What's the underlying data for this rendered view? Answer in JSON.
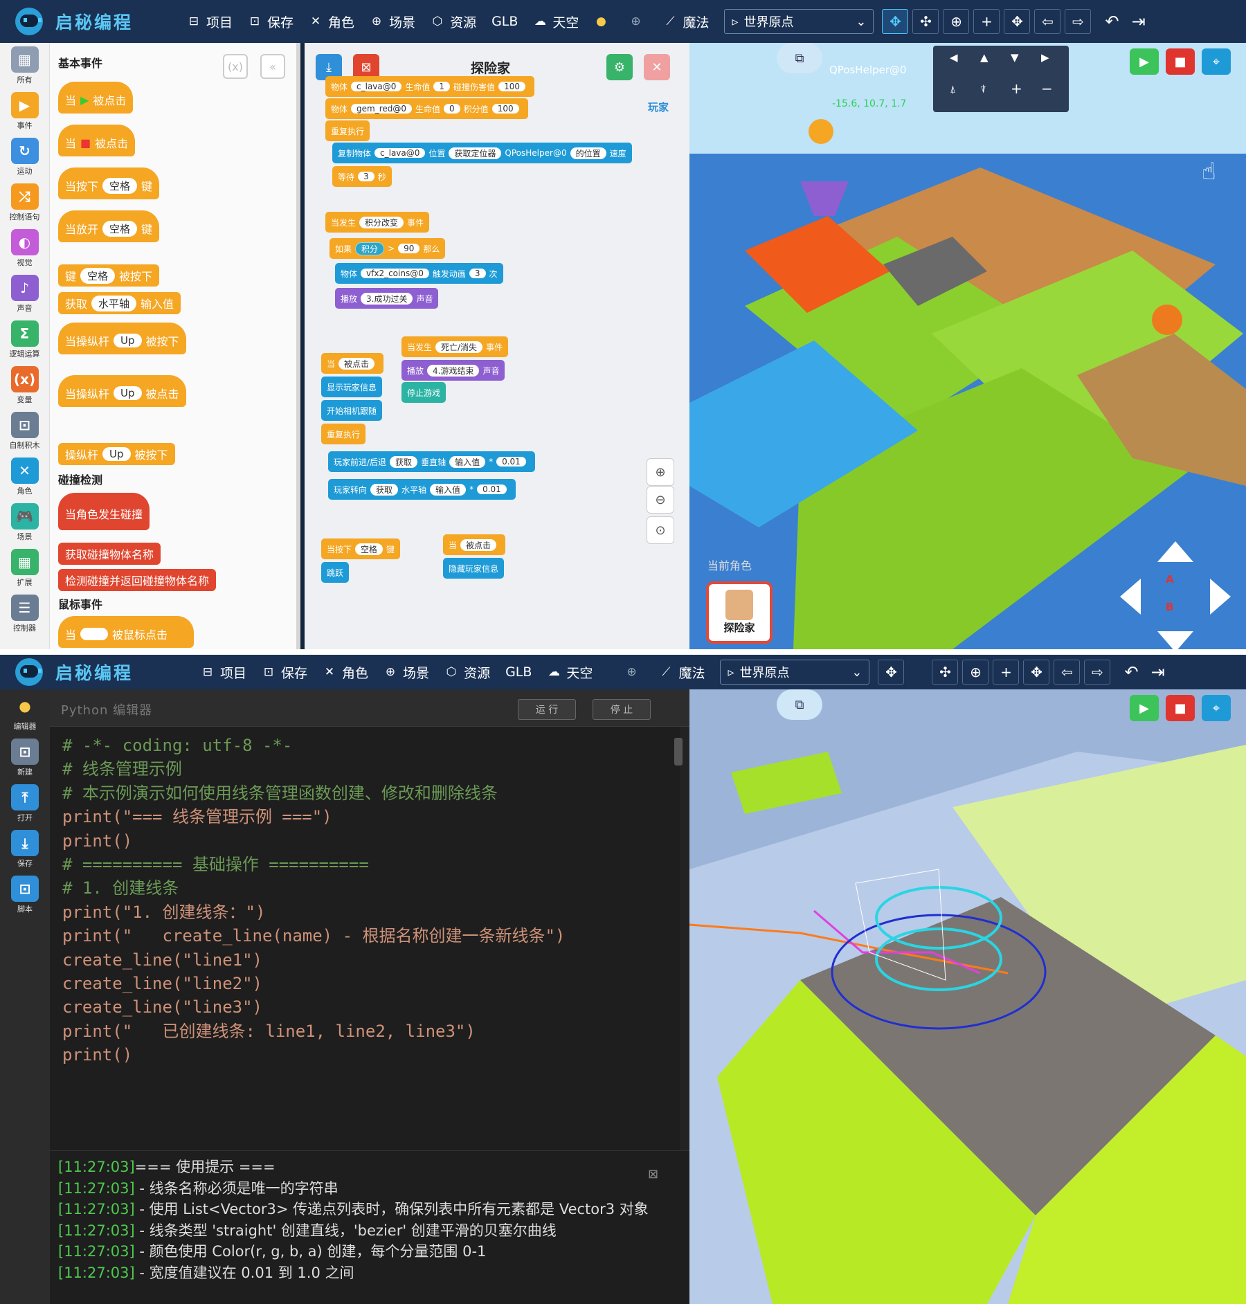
{
  "brand": "启秘编程",
  "menu": [
    {
      "icon": "save-file-icon",
      "label": "项目"
    },
    {
      "icon": "floppy-icon",
      "label": "保存"
    },
    {
      "icon": "character-icon",
      "label": "角色"
    },
    {
      "icon": "gamepad-icon",
      "label": "场景"
    },
    {
      "icon": "cube-icon",
      "label": "资源"
    },
    {
      "icon": "",
      "label": "GLB"
    },
    {
      "icon": "cloud-icon",
      "label": "天空"
    }
  ],
  "magic_label": "魔法",
  "world_origin": "世界原点",
  "categories": [
    {
      "label": "所有",
      "color": "#8f9db3",
      "glyph": "▦"
    },
    {
      "label": "事件",
      "color": "#f5a623",
      "glyph": "▶"
    },
    {
      "label": "运动",
      "color": "#3d8fe0",
      "glyph": "↻"
    },
    {
      "label": "控制语句",
      "color": "#f59a1f",
      "glyph": "⤮"
    },
    {
      "label": "视觉",
      "color": "#c45bd9",
      "glyph": "◐"
    },
    {
      "label": "声音",
      "color": "#8e5fd1",
      "glyph": "♪"
    },
    {
      "label": "逻辑运算",
      "color": "#37b36a",
      "glyph": "Σ"
    },
    {
      "label": "变量",
      "color": "#e86b2c",
      "glyph": "(x)"
    },
    {
      "label": "自制积木",
      "color": "#6b7d93",
      "glyph": "⊡"
    },
    {
      "label": "角色",
      "color": "#1e9bd7",
      "glyph": "✕"
    },
    {
      "label": "场景",
      "color": "#2bb3a3",
      "glyph": "🎮"
    },
    {
      "label": "扩展",
      "color": "#37b36a",
      "glyph": "▦"
    },
    {
      "label": "控制器",
      "color": "#6b7d93",
      "glyph": "☰"
    }
  ],
  "palette": {
    "section_basic": "基本事件",
    "section_collision": "碰撞检测",
    "section_mouse": "鼠标事件",
    "blocks": [
      {
        "pre": "当",
        "pill": "",
        "post": "被点击",
        "flag": "green"
      },
      {
        "pre": "当",
        "pill": "",
        "post": "被点击",
        "flag": "red"
      },
      {
        "pre": "当按下",
        "pill": "空格",
        "post": "键"
      },
      {
        "pre": "当放开",
        "pill": "空格",
        "post": "键"
      },
      {
        "pre": "键",
        "pill": "空格",
        "post": "被按下"
      },
      {
        "pre": "获取",
        "pill": "水平轴",
        "post": "输入值"
      },
      {
        "pre": "当操纵杆",
        "pill": "Up",
        "post": "被按下"
      },
      {
        "pre": "当操纵杆",
        "pill": "Up",
        "post": "被点击"
      },
      {
        "pre": "操纵杆",
        "pill": "Up",
        "post": "被按下"
      },
      {
        "pre": "当角色发生碰撞",
        "pill": "",
        "post": ""
      },
      {
        "pre": "获取碰撞物体名称",
        "pill": "",
        "post": ""
      },
      {
        "pre": "检测碰撞并返回碰撞物体名称",
        "pill": "",
        "post": ""
      },
      {
        "pre": "当",
        "pill": "",
        "post": "被鼠标点击"
      }
    ]
  },
  "script_title": "探险家",
  "player_label": "玩家",
  "script_blocks": [
    {
      "t": "物体|c_lava@0|生命值|1|碰撞伤害值|100"
    },
    {
      "t": "物体|gem_red@0|生命值|0|积分值|100"
    },
    {
      "t": "重复执行"
    },
    {
      "t": "复制物体|c_lava@0|位置|获取定位器|QPosHelper@0|的位置|速度"
    },
    {
      "t": "等待|3|秒"
    },
    {
      "t": "当发生|积分改变|事件"
    },
    {
      "t": "如果|积分|>|90|那么"
    },
    {
      "t": "物体|vfx2_coins@0|触发动画|3|次"
    },
    {
      "t": "播放|3.成功过关|声音"
    },
    {
      "t": "当发生|死亡/消失|事件"
    },
    {
      "t": "播放|4.游戏结束|声音"
    },
    {
      "t": "停止游戏"
    },
    {
      "t": "当|被点击"
    },
    {
      "t": "显示玩家信息"
    },
    {
      "t": "开始相机跟随"
    },
    {
      "t": "重复执行"
    },
    {
      "t": "玩家前进/后退|获取|垂直轴|输入值|*|0.01"
    },
    {
      "t": "玩家转向|获取|水平轴|输入值|*|0.01"
    },
    {
      "t": "当按下|空格|键"
    },
    {
      "t": "跳跃"
    },
    {
      "t": "当|被点击"
    },
    {
      "t": "隐藏玩家信息"
    }
  ],
  "scene": {
    "helper_name": "QPosHelper@0",
    "helper_coords": "-15.6, 10.7, 1.7",
    "current_role": "当前角色",
    "role_name": "探险家",
    "btn_a": "A",
    "btn_b": "B"
  },
  "python": {
    "editor_title": "Python 编辑器",
    "run": "运 行",
    "stop": "停 止",
    "rail": [
      "编辑器",
      "新建",
      "打开",
      "保存",
      "脚本"
    ],
    "code": [
      {
        "k": "cm",
        "v": "# -*- coding: utf-8 -*-"
      },
      {
        "k": "cm",
        "v": "# 线条管理示例"
      },
      {
        "k": "cm",
        "v": "# 本示例演示如何使用线条管理函数创建、修改和删除线条"
      },
      {
        "k": "pl",
        "v": ""
      },
      {
        "k": "st",
        "v": "print(\"=== 线条管理示例 ===\")"
      },
      {
        "k": "st",
        "v": "print()"
      },
      {
        "k": "pl",
        "v": ""
      },
      {
        "k": "cm",
        "v": "# ========== 基础操作 =========="
      },
      {
        "k": "pl",
        "v": ""
      },
      {
        "k": "cm",
        "v": "# 1. 创建线条"
      },
      {
        "k": "st",
        "v": "print(\"1. 创建线条：\")"
      },
      {
        "k": "st",
        "v": "print(\"   create_line(name) - 根据名称创建一条新线条\")"
      },
      {
        "k": "st",
        "v": "create_line(\"line1\")"
      },
      {
        "k": "st",
        "v": "create_line(\"line2\")"
      },
      {
        "k": "st",
        "v": "create_line(\"line3\")"
      },
      {
        "k": "st",
        "v": "print(\"   已创建线条: line1, line2, line3\")"
      },
      {
        "k": "st",
        "v": "print()"
      }
    ],
    "console": [
      {
        "ts": "[11:27:03]",
        "msg": "=== 使用提示 ==="
      },
      {
        "ts": "[11:27:03]",
        "msg": " - 线条名称必须是唯一的字符串"
      },
      {
        "ts": "[11:27:03]",
        "msg": " - 使用 List<Vector3> 传递点列表时，确保列表中所有元素都是 Vector3 对象"
      },
      {
        "ts": "[11:27:03]",
        "msg": " - 线条类型 'straight' 创建直线，'bezier' 创建平滑的贝塞尔曲线"
      },
      {
        "ts": "[11:27:03]",
        "msg": " - 颜色使用 Color(r, g, b, a) 创建，每个分量范围 0-1"
      },
      {
        "ts": "[11:27:03]",
        "msg": " - 宽度值建议在 0.01 到 1.0 之间"
      }
    ]
  }
}
